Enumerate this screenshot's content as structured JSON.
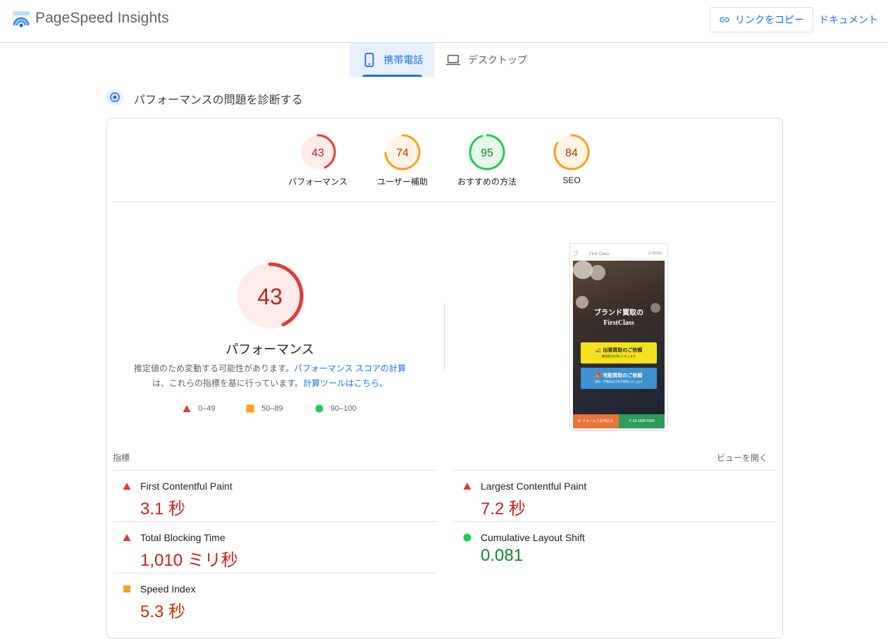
{
  "header": {
    "logo_text": "PageSpeed Insights",
    "copy_link_label": "リンクをコピー",
    "docs_label": "ドキュメント"
  },
  "tabs": [
    {
      "label": "携帯電話",
      "selected": true
    },
    {
      "label": "デスクトップ",
      "selected": false
    }
  ],
  "diagnose": {
    "title": "パフォーマンスの問題を診断する"
  },
  "categories": [
    {
      "score": "43",
      "label": "パフォーマンス",
      "score_value": 43,
      "color": "#e53935",
      "bg": "#fdecea",
      "text_color": "#c5221f"
    },
    {
      "score": "74",
      "label": "ユーザー補助",
      "score_value": 74,
      "color": "#fa9f1b",
      "bg": "#fff5e6",
      "text_color": "#c33300"
    },
    {
      "score": "95",
      "label": "おすすめの方法",
      "score_value": 95,
      "color": "#1ecc5a",
      "bg": "#e6f7ec",
      "text_color": "#0d8a29"
    },
    {
      "score": "84",
      "label": "SEO",
      "score_value": 84,
      "color": "#fa9f1b",
      "bg": "#fff5e6",
      "text_color": "#c33300"
    }
  ],
  "performance": {
    "score": "43",
    "score_value": 43,
    "title": "パフォーマンス",
    "desc_part1": "推定値のため変動する可能性があります。",
    "desc_link1": "パフォーマンス スコアの計算",
    "desc_part2": "は、これらの指標を基に行っています。",
    "desc_link2": "計算ツールはこちら。"
  },
  "legend": [
    {
      "range": "0–49",
      "shape": "triangle",
      "color": "#e53935"
    },
    {
      "range": "50–89",
      "shape": "square",
      "color": "#fa9f1b"
    },
    {
      "range": "90–100",
      "shape": "circle",
      "color": "#1ecc5a"
    }
  ],
  "screenshot": {
    "site_name": "First Class",
    "menu": "☰ MENU",
    "headline1": "ブランド買取の",
    "headline2": "FirstClass",
    "btn1": "🚚 出張買取のご依頼",
    "btn1_sub": "最短即日お伺いいたします",
    "btn2": "🎁 宅配買取のご依頼",
    "btn2_sub": "送料・手数料は当社が負担いたします",
    "foot_left": "✉ フォームでお申込み",
    "foot_right": "✆ 03-6908-5890"
  },
  "metrics_header": "指標",
  "view_open": "ビューを開く",
  "metrics": [
    {
      "name": "First Contentful Paint",
      "value": "3.1 秒",
      "status": "fail"
    },
    {
      "name": "Largest Contentful Paint",
      "value": "7.2 秒",
      "status": "fail"
    },
    {
      "name": "Total Blocking Time",
      "value": "1,010 ミリ秒",
      "status": "fail"
    },
    {
      "name": "Cumulative Layout Shift",
      "value": "0.081",
      "status": "pass"
    },
    {
      "name": "Speed Index",
      "value": "5.3 秒",
      "status": "average"
    }
  ]
}
